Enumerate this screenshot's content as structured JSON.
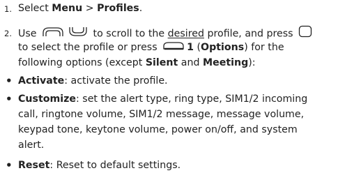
{
  "step1": {
    "number": "1.",
    "prefix": "Select ",
    "menu": "Menu",
    "sep": " > ",
    "profiles": "Profiles",
    "suffix": "."
  },
  "step2": {
    "number": "2.",
    "line1_pre": "Use",
    "line1_mid": "to scroll to the",
    "line1_underlined": "desired",
    "line1_post": "profile, and press",
    "line2_pre": "to select the profile or press",
    "line2_key_sub": "1",
    "line2_paren_open": " (",
    "line2_options": "Options",
    "line2_post": ") for the",
    "line3_pre": "following options (except ",
    "line3_silent": "Silent",
    "line3_and": " and ",
    "line3_meeting": "Meeting",
    "line3_post": "):"
  },
  "bullets": {
    "activate": {
      "term": "Activate",
      "text": ": activate the profile."
    },
    "customize": {
      "term": "Customize",
      "line1": ": set the alert type, ring type, SIM1/2 incoming",
      "line2": "call, ringtone volume, SIM1/2 message, message volume,",
      "line3": "keypad tone, keytone volume, power on/off, and system",
      "line4": "alert."
    },
    "reset": {
      "term": "Reset",
      "text": ": Reset to default settings."
    }
  },
  "icons": {
    "scroll_up": "nav-up-key-icon",
    "scroll_down": "nav-down-key-icon",
    "select": "center-select-key-icon",
    "options": "left-softkey-icon"
  }
}
